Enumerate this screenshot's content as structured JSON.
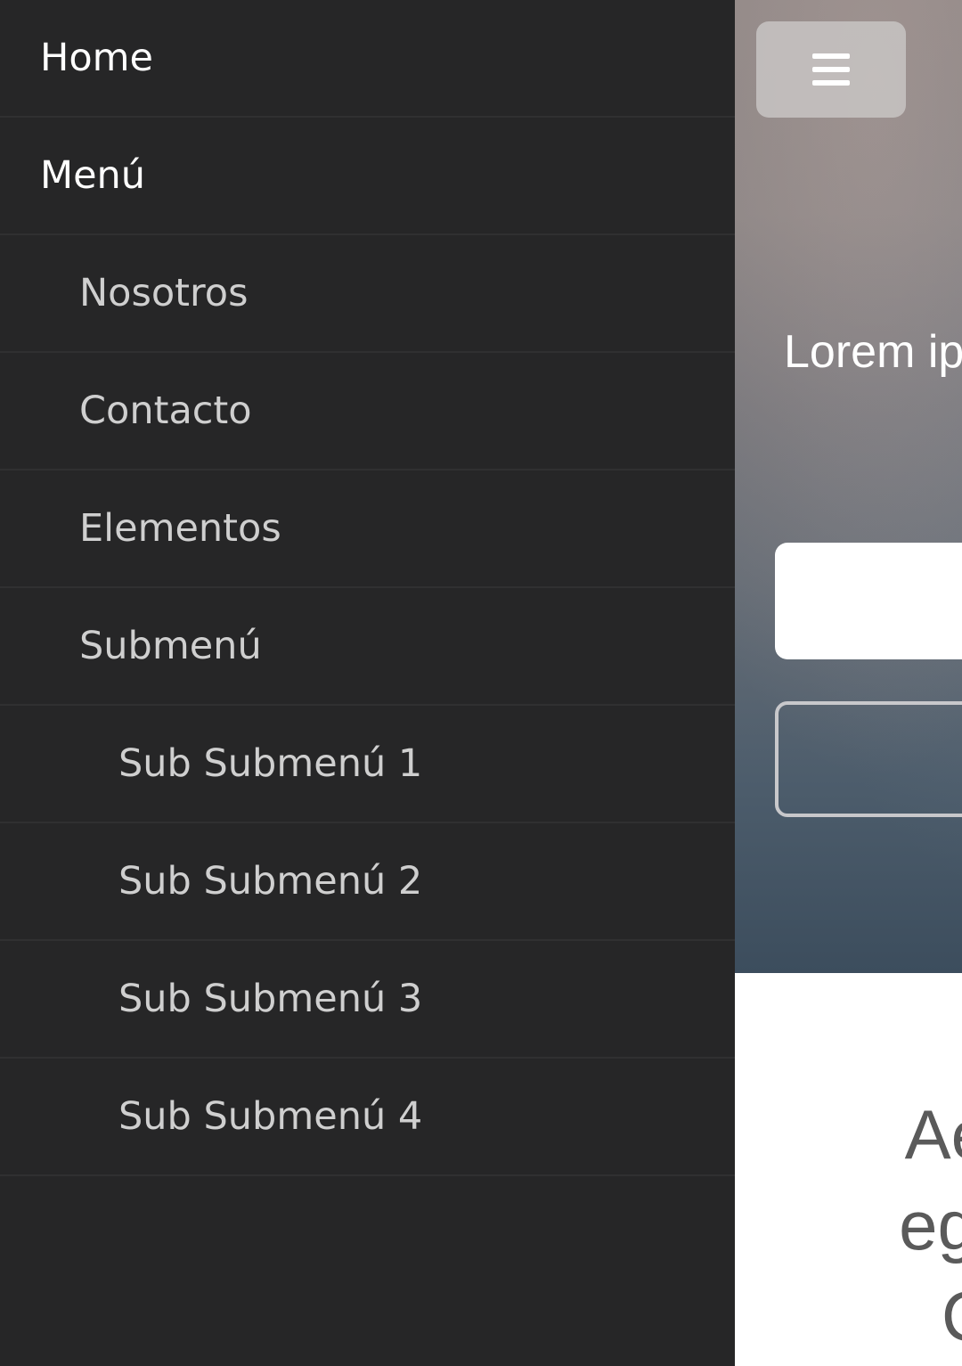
{
  "sidebar": {
    "items": [
      {
        "label": "Home"
      },
      {
        "label": "Menú"
      },
      {
        "label": "Nosotros"
      },
      {
        "label": "Contacto"
      },
      {
        "label": "Elementos"
      },
      {
        "label": "Submenú"
      },
      {
        "label": "Sub Submenú 1"
      },
      {
        "label": "Sub Submenú 2"
      },
      {
        "label": "Sub Submenú 3"
      },
      {
        "label": "Sub Submenú 4"
      }
    ]
  },
  "main": {
    "menu_toggle_icon": "hamburger-icon",
    "hero_text": "Lorem ip",
    "content_lines": [
      "Aen",
      "eget",
      "C"
    ]
  },
  "colors": {
    "sidebar_bg": "#262627",
    "sidebar_divider": "#303031",
    "text_primary": "#ffffff",
    "text_secondary": "#cfcfcf"
  }
}
